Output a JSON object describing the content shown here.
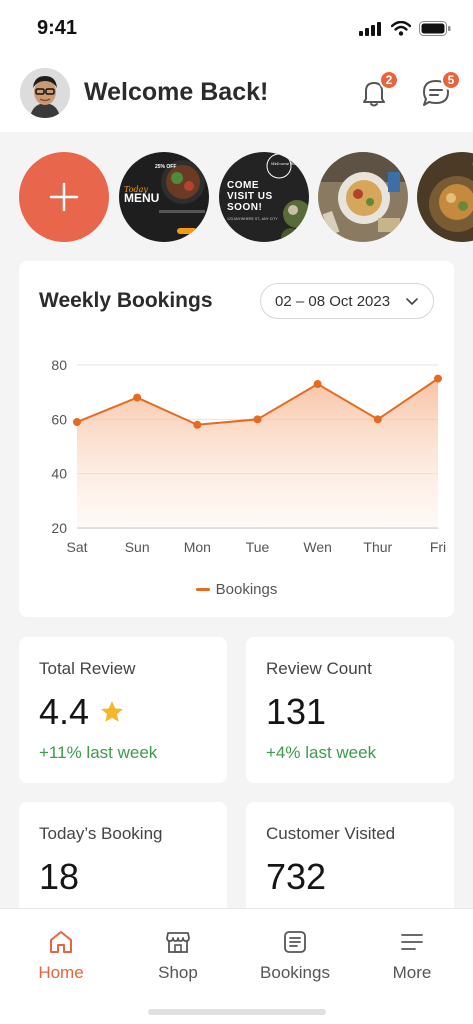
{
  "status": {
    "time": "9:41"
  },
  "header": {
    "welcome": "Welcome Back!",
    "notifications_count": "2",
    "messages_count": "5"
  },
  "stories": [
    {
      "name": "add-story",
      "text": ""
    },
    {
      "name": "menu-promo",
      "text": "Today MENU"
    },
    {
      "name": "come-visit-promo",
      "text": "COME VISIT US SOON!"
    },
    {
      "name": "food-dish-1",
      "text": ""
    },
    {
      "name": "food-dish-2",
      "text": ""
    }
  ],
  "story_text": {
    "menu_today": "Today",
    "menu_word": "MENU",
    "menu_discount": "25% OFF",
    "visit_line1": "COME",
    "visit_line2": "VISIT US",
    "visit_line3": "SOON!",
    "visit_small": "123 ANYWHERE ST., ANY CITY",
    "visit_script": "Welcome Eats"
  },
  "bookings_card": {
    "title": "Weekly Bookings",
    "date_range": "02 – 08 Oct 2023"
  },
  "chart_data": {
    "type": "area",
    "categories": [
      "Sat",
      "Sun",
      "Mon",
      "Tue",
      "Wen",
      "Thur",
      "Fri"
    ],
    "series": [
      {
        "name": "Bookings",
        "values": [
          59,
          68,
          58,
          60,
          73,
          60,
          75
        ]
      }
    ],
    "ylim": [
      20,
      80
    ],
    "yticks": [
      20,
      40,
      60,
      80
    ],
    "grid": true,
    "legend": "bottom",
    "color": "#e66a1f"
  },
  "stats": {
    "total_review": {
      "label": "Total Review",
      "value": "4.4",
      "change": "+11% last week"
    },
    "review_count": {
      "label": "Review Count",
      "value": "131",
      "change": "+4% last week"
    },
    "todays_booking": {
      "label": "Today’s Booking",
      "value": "18"
    },
    "customer_visited": {
      "label": "Customer Visited",
      "value": "732"
    }
  },
  "nav": {
    "home": "Home",
    "shop": "Shop",
    "bookings": "Bookings",
    "more": "More"
  },
  "colors": {
    "accent": "#e8643e",
    "positive": "#3e9a4c",
    "star": "#f5b727"
  }
}
